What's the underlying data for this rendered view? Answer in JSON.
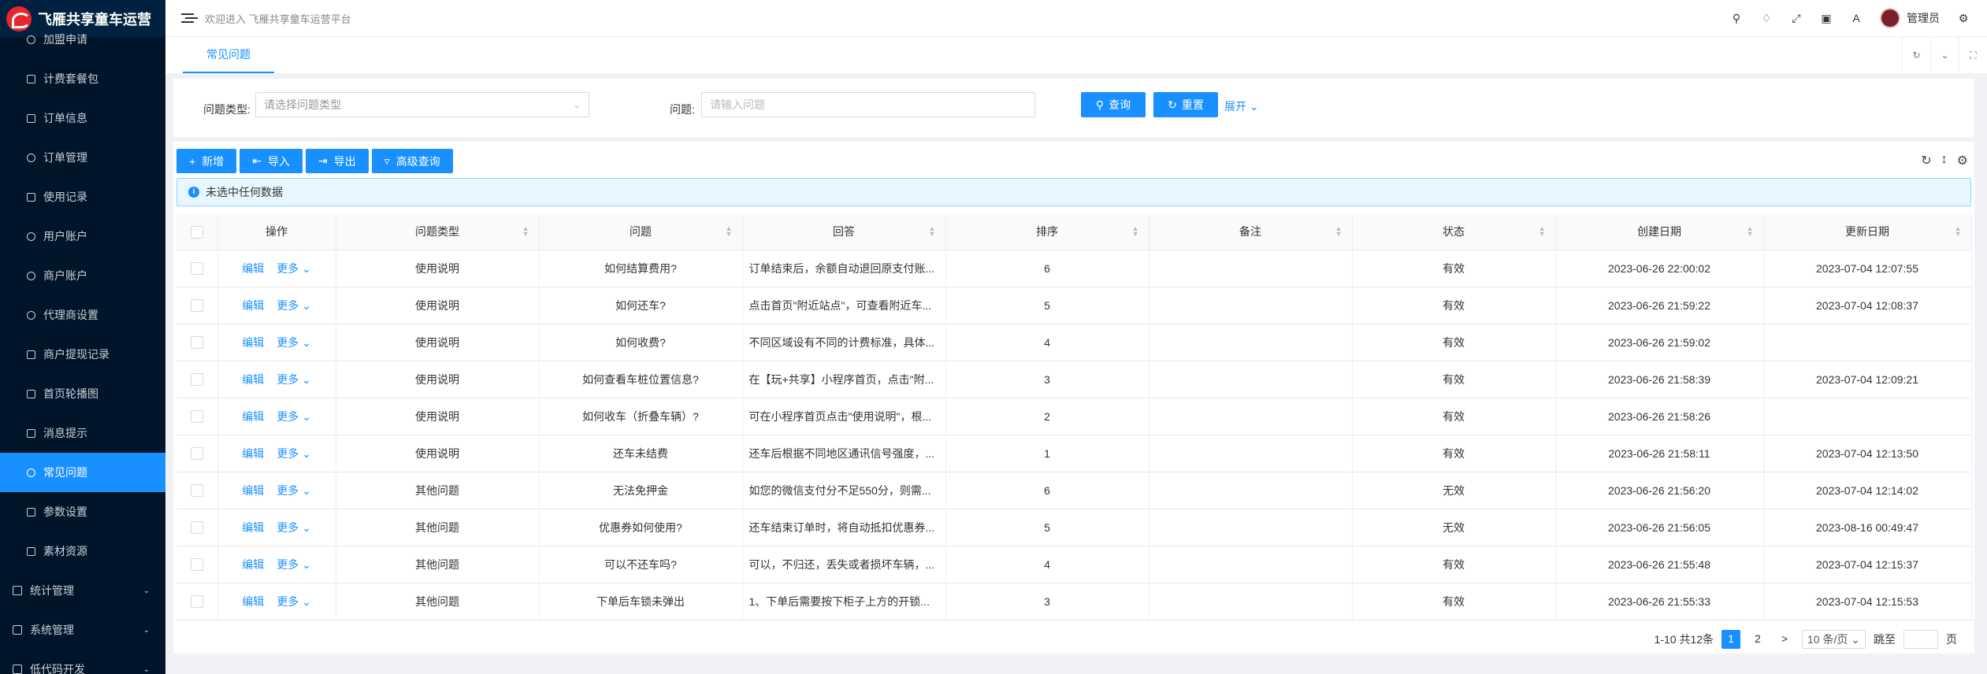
{
  "app": {
    "title": "飞雁共享童车运营",
    "welcome": "欢迎进入 飞雁共享童车运营平台"
  },
  "sidebar": {
    "items": [
      {
        "label": "加盟申请"
      },
      {
        "label": "计费套餐包"
      },
      {
        "label": "订单信息"
      },
      {
        "label": "订单管理"
      },
      {
        "label": "使用记录"
      },
      {
        "label": "用户账户"
      },
      {
        "label": "商户账户"
      },
      {
        "label": "代理商设置"
      },
      {
        "label": "商户提现记录"
      },
      {
        "label": "首页轮播图"
      },
      {
        "label": "消息提示"
      },
      {
        "label": "常见问题"
      },
      {
        "label": "参数设置"
      },
      {
        "label": "素材资源"
      }
    ],
    "groups": [
      {
        "label": "统计管理"
      },
      {
        "label": "系统管理"
      },
      {
        "label": "低代码开发"
      }
    ],
    "active": "常见问题"
  },
  "header": {
    "username": "管理员"
  },
  "tabs": [
    {
      "label": "常见问题"
    }
  ],
  "search": {
    "type_label": "问题类型:",
    "type_placeholder": "请选择问题类型",
    "question_label": "问题:",
    "question_placeholder": "请输入问题",
    "query_button": "查询",
    "reset_button": "重置",
    "expand_link": "展开"
  },
  "toolbar": {
    "add": "新增",
    "import": "导入",
    "export": "导出",
    "advanced": "高级查询"
  },
  "alert": {
    "text": "未选中任何数据"
  },
  "table": {
    "columns": [
      "操作",
      "问题类型",
      "问题",
      "回答",
      "排序",
      "备注",
      "状态",
      "创建日期",
      "更新日期"
    ],
    "edit_label": "编辑",
    "more_label": "更多",
    "rows": [
      {
        "type": "使用说明",
        "question": "如何结算费用?",
        "answer": "订单结束后，余额自动退回原支付账...",
        "order": "6",
        "remark": "",
        "status": "有效",
        "created": "2023-06-26 22:00:02",
        "updated": "2023-07-04 12:07:55"
      },
      {
        "type": "使用说明",
        "question": "如何还车?",
        "answer": "点击首页\"附近站点\"，可查看附近车...",
        "order": "5",
        "remark": "",
        "status": "有效",
        "created": "2023-06-26 21:59:22",
        "updated": "2023-07-04 12:08:37"
      },
      {
        "type": "使用说明",
        "question": "如何收费?",
        "answer": "不同区域设有不同的计费标准，具体...",
        "order": "4",
        "remark": "",
        "status": "有效",
        "created": "2023-06-26 21:59:02",
        "updated": ""
      },
      {
        "type": "使用说明",
        "question": "如何查看车桩位置信息?",
        "answer": "在【玩+共享】小程序首页，点击\"附...",
        "order": "3",
        "remark": "",
        "status": "有效",
        "created": "2023-06-26 21:58:39",
        "updated": "2023-07-04 12:09:21"
      },
      {
        "type": "使用说明",
        "question": "如何收车（折叠车辆）?",
        "answer": "可在小程序首页点击\"使用说明\"，根...",
        "order": "2",
        "remark": "",
        "status": "有效",
        "created": "2023-06-26 21:58:26",
        "updated": ""
      },
      {
        "type": "使用说明",
        "question": "还车未结费",
        "answer": "还车后根据不同地区通讯信号强度，...",
        "order": "1",
        "remark": "",
        "status": "有效",
        "created": "2023-06-26 21:58:11",
        "updated": "2023-07-04 12:13:50"
      },
      {
        "type": "其他问题",
        "question": "无法免押金",
        "answer": "如您的微信支付分不足550分，则需...",
        "order": "6",
        "remark": "",
        "status": "无效",
        "created": "2023-06-26 21:56:20",
        "updated": "2023-07-04 12:14:02"
      },
      {
        "type": "其他问题",
        "question": "优惠券如何使用?",
        "answer": "还车结束订单时，将自动抵扣优惠券...",
        "order": "5",
        "remark": "",
        "status": "无效",
        "created": "2023-06-26 21:56:05",
        "updated": "2023-08-16 00:49:47"
      },
      {
        "type": "其他问题",
        "question": "可以不还车吗?",
        "answer": "可以，不归还，丢失或者损坏车辆，...",
        "order": "4",
        "remark": "",
        "status": "有效",
        "created": "2023-06-26 21:55:48",
        "updated": "2023-07-04 12:15:37"
      },
      {
        "type": "其他问题",
        "question": "下单后车锁未弹出",
        "answer": "1、下单后需要按下柜子上方的开锁...",
        "order": "3",
        "remark": "",
        "status": "有效",
        "created": "2023-06-26 21:55:33",
        "updated": "2023-07-04 12:15:53"
      }
    ]
  },
  "pagination": {
    "summary": "1-10 共12条",
    "pages": [
      "1",
      "2"
    ],
    "next": ">",
    "page_size": "10 条/页",
    "jump_label": "跳至",
    "page_unit": "页"
  },
  "colors": {
    "primary": "#1890ff",
    "sidebar_bg": "#001529"
  }
}
